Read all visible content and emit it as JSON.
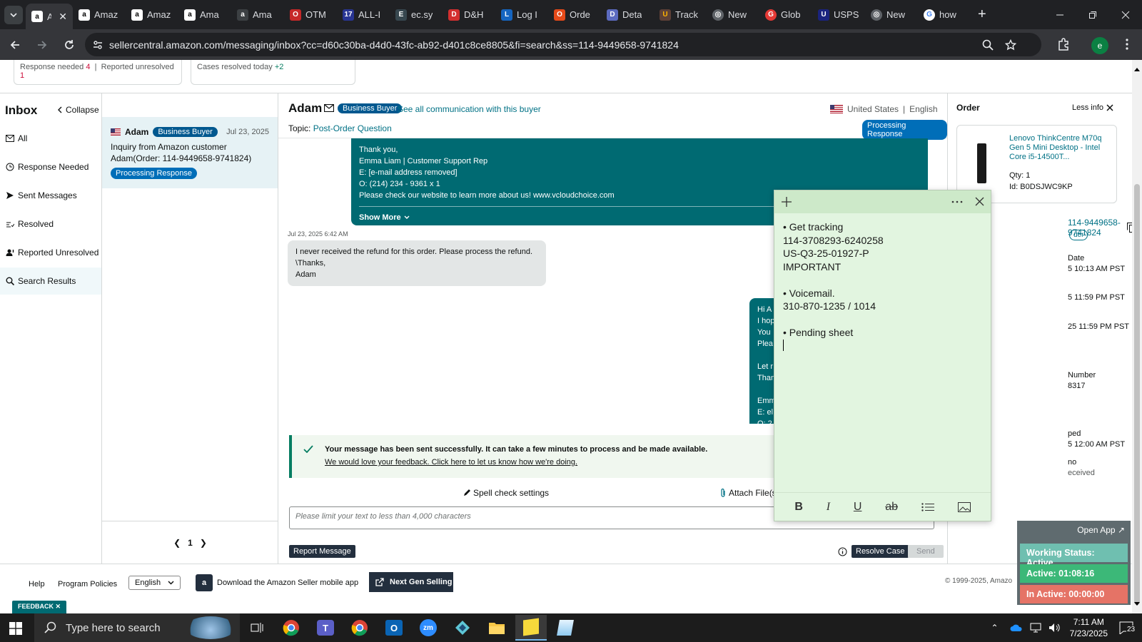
{
  "browser": {
    "tabs": [
      {
        "label": "A",
        "icon": "amazon-icon",
        "active": true
      },
      {
        "label": "Amaz",
        "icon": "amazon-icon"
      },
      {
        "label": "Amaz",
        "icon": "amazon-icon"
      },
      {
        "label": "Ama",
        "icon": "amazon-icon"
      },
      {
        "label": "Ama",
        "icon": "amazon-icon"
      },
      {
        "label": "OTM",
        "icon": "otm-icon"
      },
      {
        "label": "ALL-I",
        "icon": "seventeen-track-icon"
      },
      {
        "label": "ec.sy",
        "icon": "ec-icon"
      },
      {
        "label": "D&H",
        "icon": "dh-icon"
      },
      {
        "label": "Log I",
        "icon": "log-icon"
      },
      {
        "label": "Orde",
        "icon": "order-icon"
      },
      {
        "label": "Deta",
        "icon": "detail-icon"
      },
      {
        "label": "Track",
        "icon": "ups-icon"
      },
      {
        "label": "New",
        "icon": "globe-icon"
      },
      {
        "label": "Glob",
        "icon": "glob-icon"
      },
      {
        "label": "USPS",
        "icon": "usps-icon"
      },
      {
        "label": "New",
        "icon": "globe-icon"
      },
      {
        "label": "how",
        "icon": "google-icon"
      }
    ],
    "url": "sellercentral.amazon.com/messaging/inbox?cc=d60c30ba-d4d0-43fc-ab92-d401c8ce8805&fi=search&ss=114-9449658-9741824",
    "profile_initial": "e"
  },
  "top_cards": {
    "response_needed_label": "Response needed",
    "response_needed_count": "4",
    "reported_unresolved_label": "Reported unresolved",
    "reported_unresolved_count": "1",
    "cases_resolved_label": "Cases resolved today",
    "cases_resolved_count": "+2"
  },
  "inbox": {
    "title": "Inbox",
    "collapse_label": "Collapse",
    "nav": [
      {
        "label": "All",
        "icon": "mail-icon"
      },
      {
        "label": "Response Needed",
        "icon": "clock-icon"
      },
      {
        "label": "Sent Messages",
        "icon": "send-icon"
      },
      {
        "label": "Resolved",
        "icon": "resolved-icon"
      },
      {
        "label": "Reported Unresolved",
        "icon": "report-icon"
      },
      {
        "label": "Search Results",
        "icon": "search-icon"
      }
    ]
  },
  "conversation_list": {
    "items": [
      {
        "name": "Adam",
        "badge": "Business Buyer",
        "date": "Jul 23, 2025",
        "line1": "Inquiry from Amazon customer",
        "line2": "Adam(Order: 114-9449658-9741824)",
        "status": "Processing Response"
      }
    ],
    "page": "1"
  },
  "conversation": {
    "buyer_name": "Adam",
    "badge": "Business Buyer",
    "see_all": "See all communication with this buyer",
    "country": "United States",
    "language": "English",
    "topic_label": "Topic:",
    "topic": "Post-Order Question",
    "status": "Processing Response",
    "outgoing_top": {
      "lines": [
        "Thank you,",
        "Emma Liam | Customer Support Rep",
        "E: [e-mail address removed]",
        "O: (214) 234 - 9361 x  1",
        "Please check our website to learn more about us! www.vcloudchoice.com"
      ],
      "show_more": "Show More"
    },
    "incoming": {
      "timestamp": "Jul 23, 2025 6:42 AM",
      "lines": [
        "I never received the refund for this order. Please process the refund.",
        "\\Thanks,",
        "Adam"
      ]
    },
    "outgoing_bottom_fragments": [
      "Hi A",
      "I hop",
      "You",
      "Plea",
      "",
      "Let r",
      "Than",
      "",
      "Emm",
      "E: el",
      "O: 2"
    ],
    "success_title": "Your message has been sent successfully. It can take a few minutes to process and be made available.",
    "success_link": "We would love your feedback. Click here to let us know how we're doing.",
    "spell_check": "Spell check settings",
    "attach": "Attach File(s",
    "reply_placeholder": "Please limit your text to less than 4,000 characters",
    "report_button": "Report Message",
    "resolve_button": "Resolve Case",
    "send_button": "Send"
  },
  "order_panel": {
    "title": "Order",
    "less_info": "Less info",
    "product_title": "Lenovo ThinkCentre M70q Gen 5 Mini Desktop - Intel Core i5-14500T...",
    "qty_label": "Qty:",
    "qty": "1",
    "id_label": "Id:",
    "id": "B0DSJWC9KP",
    "order_id_visible": "114-9449658-9741824",
    "tag_fragment": "der",
    "frag1_label": "Date",
    "frag1_value": "5 10:13 AM PST",
    "frag2_value": "5 11:59 PM PST",
    "frag3_value": "25 11:59 PM PST",
    "frag4_label": "Number",
    "frag4_value": "8317",
    "frag5_label": "ped",
    "frag5_value": "5 12:00 AM PST",
    "frag6_label": "no",
    "frag6_value": "eceived"
  },
  "footer": {
    "help": "Help",
    "program_policies": "Program Policies",
    "language": "English",
    "download_app": "Download the Amazon Seller mobile app",
    "next_gen": "Next Gen Selling",
    "copyright": "© 1999-2025, Amazo",
    "feedback": "FEEDBACK"
  },
  "sticky_note": {
    "lines": [
      "• Get tracking",
      "114-3708293-6240258",
      "US-Q3-25-01927-P",
      "IMPORTANT",
      "",
      "• Voicemail.",
      "310-870-1235 / 1014",
      "",
      "• Pending sheet"
    ],
    "toolbar": {
      "bold": "B",
      "italic": "I",
      "underline": "U",
      "strike": "ab"
    }
  },
  "status_widget": {
    "open_app": "Open App",
    "working_status": "Working Status: Active",
    "active": "Active: 01:08:16",
    "inactive": "In Active: 00:00:00",
    "colors": {
      "working": "#6fbfb0",
      "active": "#3cb878",
      "inactive": "#e57366"
    }
  },
  "taskbar": {
    "search_placeholder": "Type here to search",
    "time": "7:11 AM",
    "date": "7/23/2025",
    "notification_count": "23",
    "apps": [
      "chrome-icon",
      "teams-icon",
      "chrome-alt-icon",
      "outlook-icon",
      "zoom-icon",
      "app-diamond-icon",
      "file-explorer-icon",
      "sticky-notes-icon",
      "notepad-icon"
    ]
  }
}
